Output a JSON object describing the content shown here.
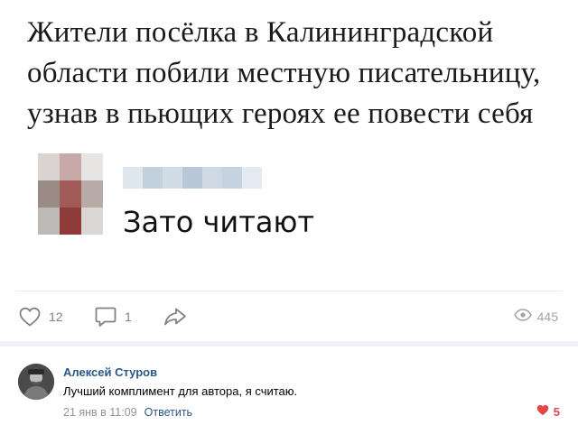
{
  "post": {
    "headline": "Жители посёлка в Калининградской области побили местную писательницу, узнав в пьющих героях ее повести себя",
    "reply_text": "Зато читают"
  },
  "actions": {
    "likes": "12",
    "comments": "1",
    "views": "445"
  },
  "comment": {
    "author": "Алексей Стуров",
    "text": "Лучший комплимент для автора, я считаю.",
    "date": "21 янв в 11:09",
    "reply_label": "Ответить",
    "likes": "5"
  },
  "colors": {
    "link": "#2a5885",
    "icon_gray": "#828282",
    "like_red": "#e64646"
  }
}
